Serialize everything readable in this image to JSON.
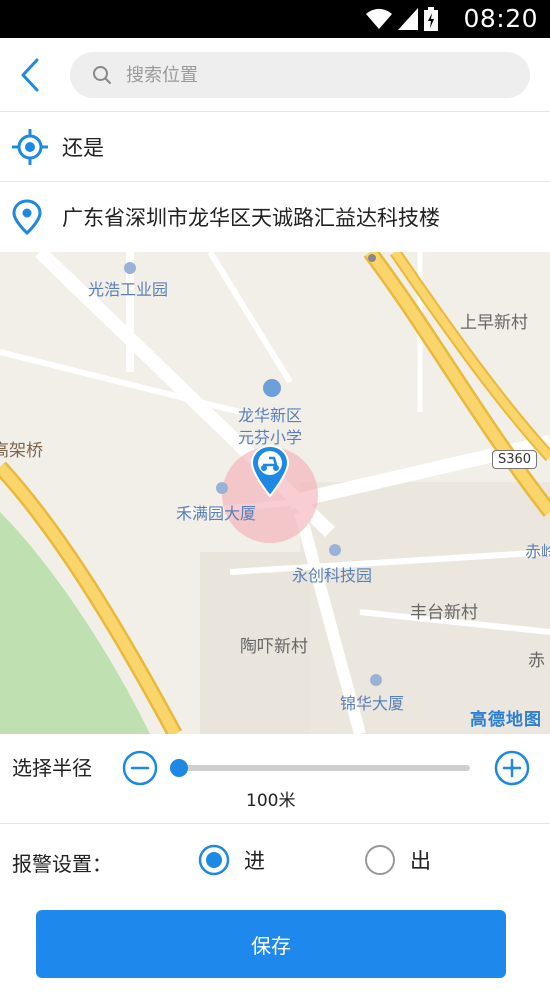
{
  "status_bar": {
    "time": "08:20",
    "icons": [
      "wifi-icon",
      "signal-icon",
      "battery-icon"
    ]
  },
  "search": {
    "placeholder": "搜索位置",
    "value": ""
  },
  "location_rows": {
    "current": "还是",
    "address": "广东省深圳市龙华区天诚路汇益达科技楼"
  },
  "map": {
    "labels": {
      "guanghao": "光浩工业园",
      "shangzao": "上早新村",
      "school_line1": "龙华新区",
      "school_line2": "元芬小学",
      "gaojiaqiao": "高架桥",
      "hemanyuan": "禾满园大厦",
      "yongchuang": "永创科技园",
      "chi1": "赤岭",
      "fengtai": "丰台新村",
      "taoxu": "陶吓新村",
      "chi2": "赤",
      "jinhua": "锦华大厦",
      "road_s360": "S360",
      "logo": "高德地图"
    },
    "fence_radius_m": 100
  },
  "radius": {
    "label": "选择半径",
    "value_label": "100米",
    "slider_fraction": 0.0
  },
  "alarm": {
    "label": "报警设置：",
    "options": [
      "进",
      "出"
    ],
    "selected": "进"
  },
  "save_button": "保存",
  "colors": {
    "accent": "#1e88e5",
    "map_bg": "#f2efe9",
    "highway": "#f7c948",
    "fence": "#f4a6ae"
  }
}
